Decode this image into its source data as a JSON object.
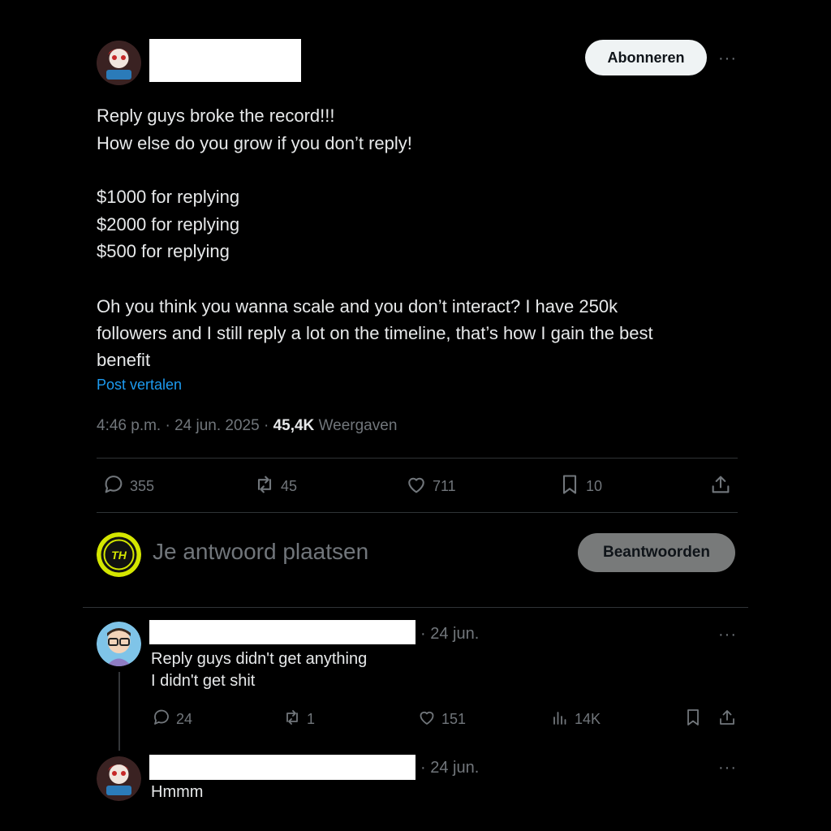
{
  "post": {
    "follow_label": "Abonneren",
    "more": "···",
    "lines": [
      "Reply guys broke the record!!!",
      "How else do you grow if you don’t reply!",
      "$1000 for replying",
      "$2000 for replying",
      "$500 for replying",
      "Oh you think you wanna scale and you don’t interact? I have 250k",
      "followers and I still reply a lot on the timeline, that’s how I gain the best",
      "benefit"
    ],
    "translate": "Post vertalen",
    "time": "4:46 p.m. · 24 jun. 2025 · ",
    "views_count": "45,4K",
    "views_label": "Weergaven",
    "stats": {
      "replies": "355",
      "reposts": "45",
      "likes": "711",
      "bookmarks": "10"
    }
  },
  "compose": {
    "avatar_text": "TH",
    "placeholder": "Je antwoord plaatsen",
    "reply_button": "Beantwoorden"
  },
  "replies": [
    {
      "date": "· 24 jun.",
      "lines": [
        "Reply guys didn't get anything",
        "I didn't get shit"
      ],
      "more": "···",
      "stats": {
        "replies": "24",
        "reposts": "1",
        "likes": "151",
        "views": "14K"
      }
    },
    {
      "date": "· 24 jun.",
      "lines": [
        "Hmmm"
      ],
      "more": "···"
    }
  ],
  "colors": {
    "background": "#000000",
    "text": "#e7e9ea",
    "muted": "#71767b",
    "link": "#1d9bf0",
    "divider": "#2f3336",
    "accent_yellow": "#d4e600"
  }
}
